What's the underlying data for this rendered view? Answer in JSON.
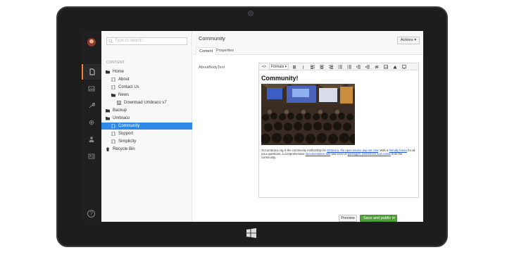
{
  "search": {
    "placeholder": "Type to search..."
  },
  "tree": {
    "section_title": "CONTENT",
    "nodes": [
      {
        "label": "Home"
      },
      {
        "label": "About"
      },
      {
        "label": "Contact Us"
      },
      {
        "label": "News"
      },
      {
        "label": "Download Umbraco v7"
      },
      {
        "label": "Backup"
      },
      {
        "label": "Umbraco"
      },
      {
        "label": "Community"
      },
      {
        "label": "Support"
      },
      {
        "label": "Simplicity"
      },
      {
        "label": "Recycle Bin"
      }
    ]
  },
  "editor": {
    "title": "Community",
    "actions_label": "Actions ▾",
    "tabs": [
      {
        "label": "Content"
      },
      {
        "label": "Properties"
      }
    ],
    "property_label": "AboutBodyText",
    "toolbar": {
      "source": "<>",
      "formats": "Formats ▾"
    },
    "heading": "Community!",
    "body": {
      "p1": "Our.umbraco.org is the community mothership for ",
      "link1": "Umbraco, the open source asp.net cms",
      "p2": ". With a ",
      "link2": "friendly forum",
      "p3": " for all your questions, a comprehensive ",
      "link3": "documentation wiki",
      "p4": " and a ton of ",
      "link4": "packages, extensions and extras",
      "p5": " from the community."
    },
    "preview_label": "Preview",
    "save_label": "Save and publish"
  },
  "colors": {
    "accent_orange": "#f5813a",
    "selection_blue": "#2e8ae6",
    "save_green": "#52a43a",
    "link_blue": "#1c4fd6"
  },
  "icons": {
    "nav": [
      "content-icon",
      "media-icon",
      "developer-icon",
      "settings-icon",
      "users-icon",
      "members-icon",
      "help-icon"
    ],
    "windows_logo": "windows-logo-icon"
  }
}
